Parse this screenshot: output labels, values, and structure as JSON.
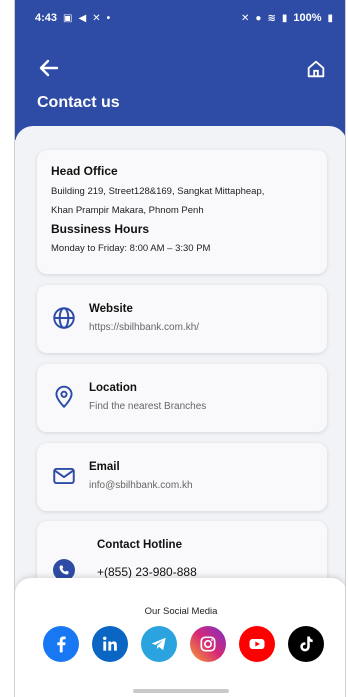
{
  "status_bar": {
    "time": "4:43",
    "battery": "100%"
  },
  "header": {
    "title": "Contact us"
  },
  "office": {
    "heading": "Head Office",
    "address_line1": "Building 219, Street128&169, Sangkat Mittapheap,",
    "address_line2": "Khan Prampir Makara, Phnom Penh",
    "hours_heading": "Bussiness Hours",
    "hours_value": "Monday to Friday: 8:00 AM – 3:30 PM"
  },
  "website": {
    "title": "Website",
    "value": "https://sbilhbank.com.kh/"
  },
  "location": {
    "title": "Location",
    "value": "Find the nearest Branches"
  },
  "email": {
    "title": "Email",
    "value": "info@sbilhbank.com.kh"
  },
  "hotline": {
    "title": "Contact Hotline",
    "value": "+(855) 23-980-888"
  },
  "social": {
    "title": "Our Social Media",
    "icons": [
      "facebook-icon",
      "linkedin-icon",
      "telegram-icon",
      "instagram-icon",
      "youtube-icon",
      "tiktok-icon"
    ]
  },
  "colors": {
    "primary": "#2e4ca6",
    "facebook": "#1877f2",
    "linkedin": "#0a66c2",
    "telegram": "#2aa3df",
    "instagram": "#d62976",
    "youtube": "#ff0000",
    "tiktok": "#000000"
  }
}
